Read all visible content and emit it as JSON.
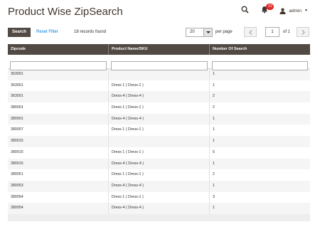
{
  "page": {
    "title": "Product Wise ZipSearch"
  },
  "header": {
    "notifications_count": "22",
    "user_name": "admin"
  },
  "toolbar": {
    "search_label": "Search",
    "reset_label": "Reset Filter",
    "records_found": "18 records found",
    "per_page_value": "20",
    "per_page_label": "per page",
    "current_page": "1",
    "of_pages": "of 1"
  },
  "grid": {
    "columns": [
      "Zipcode",
      "Product Name/SKU",
      "Number Of Search"
    ],
    "rows": [
      [
        "363001",
        "",
        "1"
      ],
      [
        "363001",
        "Dress 1 ( Dress-1 )",
        "1"
      ],
      [
        "363001",
        "Dress-4 ( Dress-4 )",
        "2"
      ],
      [
        "380001",
        "Dress 1 ( Dress-1 )",
        "2"
      ],
      [
        "380001",
        "Dress-4 ( Dress-4 )",
        "1"
      ],
      [
        "380007",
        "Dress 1 ( Dress-1 )",
        "1"
      ],
      [
        "380015",
        "",
        "1"
      ],
      [
        "380015",
        "Dress 1 ( Dress-1 )",
        "5"
      ],
      [
        "380015",
        "Dress-4 ( Dress-4 )",
        "1"
      ],
      [
        "380051",
        "Dress 1 ( Dress-1 )",
        "2"
      ],
      [
        "380053",
        "Dress-4 ( Dress-4 )",
        "1"
      ],
      [
        "380054",
        "Dress 1 ( Dress-1 )",
        "3"
      ],
      [
        "380054",
        "Dress-4 ( Dress-4 )",
        "1"
      ]
    ]
  }
}
